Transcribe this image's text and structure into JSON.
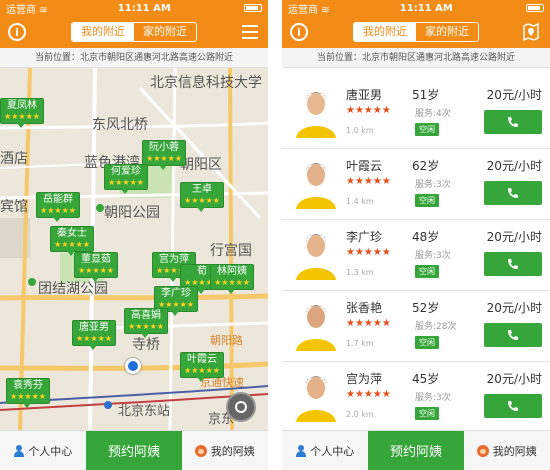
{
  "status": {
    "carrier": "运营商",
    "time": "11:11 AM"
  },
  "nav": {
    "tab_near_me": "我的附近",
    "tab_near_home": "家的附近",
    "info_symbol": "i"
  },
  "location": {
    "text": "当前位置：北京市朝阳区通惠河北路高速公路附近"
  },
  "map": {
    "labels": [
      "北京信息科技大学",
      "东风北桥",
      "酒店",
      "蓝色港湾",
      "朝阳区",
      "宾馆",
      "朝阳公园",
      "团结湖公园",
      "行宫国",
      "朝阳路",
      "寺桥",
      "京通快速",
      "北京东站",
      "京东"
    ],
    "markers": [
      {
        "name": "夏凤林",
        "stars": "★★★★★"
      },
      {
        "name": "阮小蓉",
        "stars": "★★★★★"
      },
      {
        "name": "何爱珍",
        "stars": "★★★★★"
      },
      {
        "name": "岳能群",
        "stars": "★★★★★"
      },
      {
        "name": "王卓",
        "stars": "★★★★★"
      },
      {
        "name": "秦女士",
        "stars": "★★★★★"
      },
      {
        "name": "董显茹",
        "stars": "★★★★★"
      },
      {
        "name": "宫为萍",
        "stars": "★★★★★"
      },
      {
        "name": "荀",
        "stars": "★★★★★"
      },
      {
        "name": "林阿姨",
        "stars": "★★★★★"
      },
      {
        "name": "李广珍",
        "stars": "★★★★★"
      },
      {
        "name": "高喜娟",
        "stars": "★★★★★"
      },
      {
        "name": "唐亚男",
        "stars": "★★★★★"
      },
      {
        "name": "叶霞云",
        "stars": "★★★★★"
      },
      {
        "name": "袁秀芬",
        "stars": "★★★★★"
      }
    ]
  },
  "tabbar": {
    "left": "个人中心",
    "middle": "预约阿姨",
    "right": "我的阿姨"
  },
  "list": [
    {
      "name": "唐亚男",
      "age": "51岁",
      "price": "20元/小时",
      "stars": "★★★★★",
      "service": "服务:4次",
      "distance": "1.0 km",
      "tag": "空闲"
    },
    {
      "name": "叶霞云",
      "age": "62岁",
      "price": "20元/小时",
      "stars": "★★★★★",
      "service": "服务:3次",
      "distance": "1.4 km",
      "tag": "空闲"
    },
    {
      "name": "李广珍",
      "age": "48岁",
      "price": "20元/小时",
      "stars": "★★★★★",
      "service": "服务:3次",
      "distance": "1.3 km",
      "tag": "空闲"
    },
    {
      "name": "张香艳",
      "age": "52岁",
      "price": "20元/小时",
      "stars": "★★★★★",
      "service": "服务:28次",
      "distance": "1.7 km",
      "tag": "空闲"
    },
    {
      "name": "宫为萍",
      "age": "45岁",
      "price": "20元/小时",
      "stars": "★★★★★",
      "service": "服务:3次",
      "distance": "2.0 km",
      "tag": "空闲"
    }
  ],
  "colors": {
    "brand_orange": "#f28c16",
    "green": "#37a63a",
    "star_red": "#e84e1b"
  }
}
